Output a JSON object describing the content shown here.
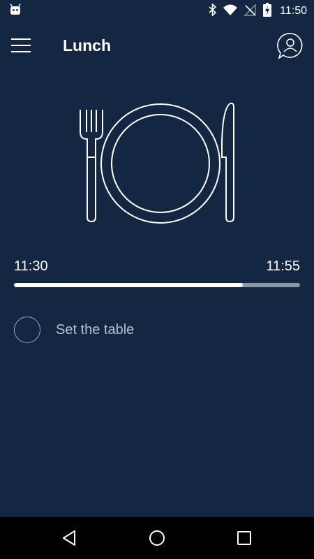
{
  "status_bar": {
    "time": "11:50",
    "icons": [
      "android-icon",
      "bluetooth-icon",
      "wifi-icon",
      "no-signal-icon",
      "battery-charging-icon"
    ]
  },
  "app_bar": {
    "title": "Lunch",
    "menu_icon": "hamburger-menu-icon",
    "profile_icon": "user-profile-icon"
  },
  "illustration": {
    "icon": "plate-fork-knife-icon"
  },
  "timeline": {
    "start_time": "11:30",
    "end_time": "11:55",
    "progress_fraction": 0.8
  },
  "tasks": [
    {
      "label": "Set the table",
      "checked": false
    }
  ],
  "nav_bar": {
    "icons": [
      "back-icon",
      "home-icon",
      "recents-icon"
    ]
  },
  "colors": {
    "background": "#132743",
    "progress_fill": "#ffffff",
    "progress_track": "#8a96a8",
    "task_text": "#b8c2d1"
  }
}
